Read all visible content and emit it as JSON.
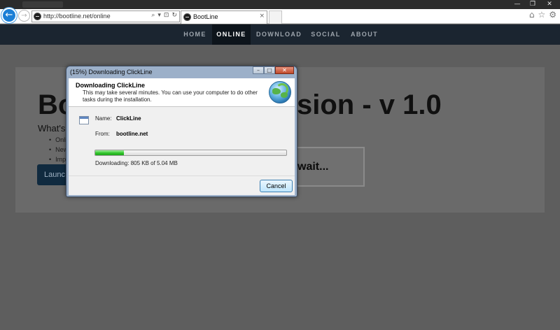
{
  "browser": {
    "url": "http://bootline.net/online",
    "tab_title": "BootLine",
    "address_icons": [
      "⌕",
      "▾",
      "⊡",
      "↻"
    ],
    "tab_close": "×",
    "back_glyph": "←",
    "forward_glyph": "→",
    "window_controls": [
      "—",
      "❐",
      "✕"
    ],
    "right_tools": [
      "⌂",
      "☆",
      "⚙"
    ]
  },
  "site_nav": {
    "items": [
      {
        "label": "HOME"
      },
      {
        "label": "ONLINE",
        "active": true
      },
      {
        "label": "DOWNLOAD"
      },
      {
        "label": "SOCIAL"
      },
      {
        "label": "ABOUT"
      }
    ]
  },
  "page": {
    "title_left": "Bo",
    "title_right": "sion - v 1.0",
    "subtitle": "What's",
    "list": [
      "Onli",
      "New",
      "Imp"
    ],
    "launch_label": "Launc",
    "wait_text": "wait..."
  },
  "dialog": {
    "title": "(15%) Downloading ClickLine",
    "controls": [
      "–",
      "□",
      "✕"
    ],
    "header_title": "Downloading ClickLine",
    "header_desc": "This may take several minutes. You can use your computer to do other tasks during the installation.",
    "name_label": "Name:",
    "name_value": "ClickLine",
    "from_label": "From:",
    "from_value": "bootline.net",
    "progress_percent": 15,
    "progress_text": "Downloading: 805 KB of 5.04 MB",
    "cancel_label": "Cancel"
  }
}
